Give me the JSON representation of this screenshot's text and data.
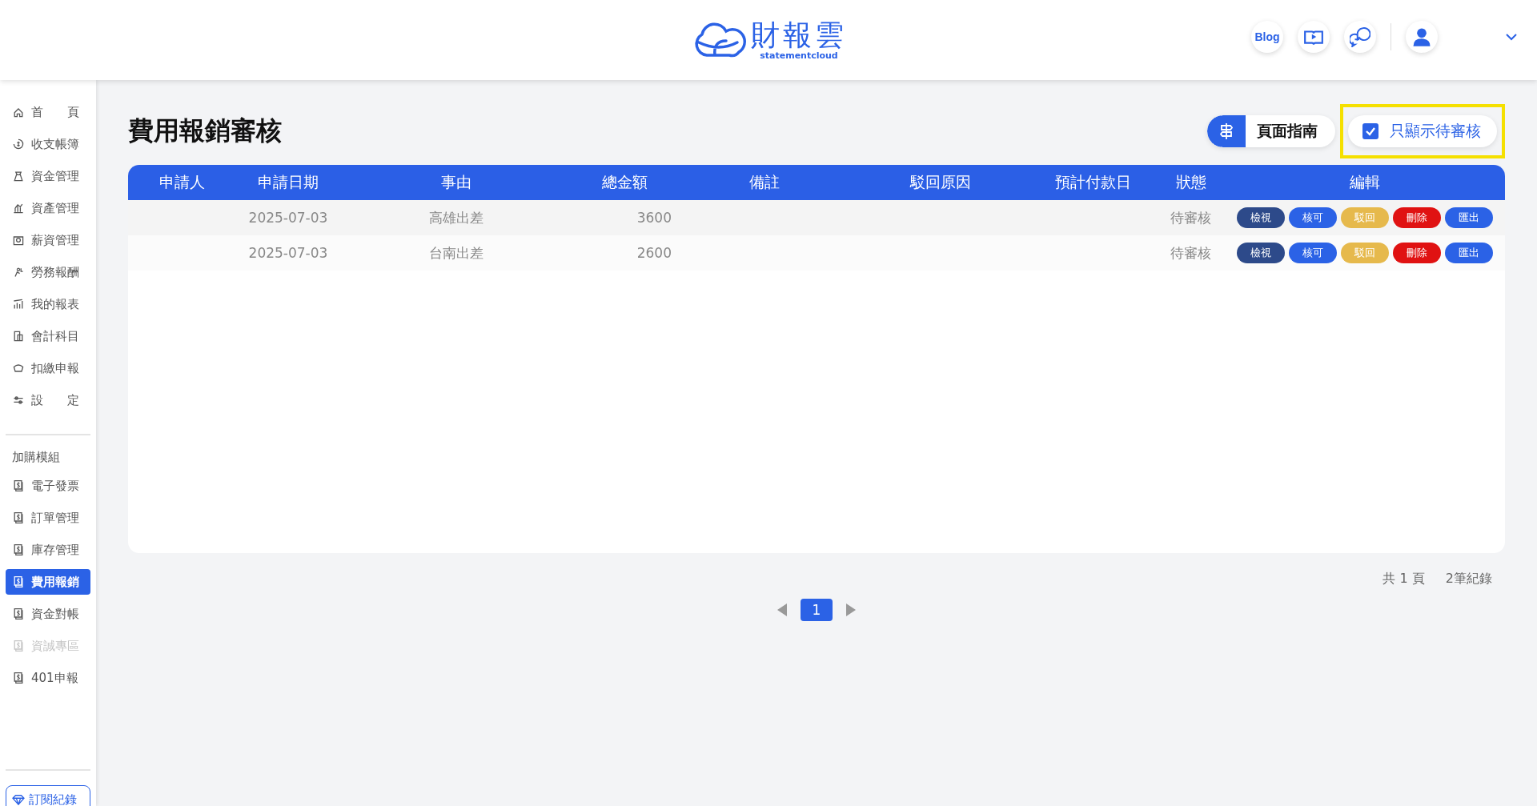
{
  "header": {
    "logo_text": "財報雲",
    "logo_subtext": "statementcloud",
    "blog_label": "Blog"
  },
  "sidebar": {
    "main_items": [
      {
        "label": "首　　頁",
        "selected": false
      },
      {
        "label": "收支帳簿",
        "selected": false
      },
      {
        "label": "資金管理",
        "selected": false
      },
      {
        "label": "資產管理",
        "selected": false
      },
      {
        "label": "薪資管理",
        "selected": false
      },
      {
        "label": "勞務報酬",
        "selected": false
      },
      {
        "label": "我的報表",
        "selected": false
      },
      {
        "label": "會計科目",
        "selected": false
      },
      {
        "label": "扣繳申報",
        "selected": false
      },
      {
        "label": "設　　定",
        "selected": false
      }
    ],
    "module_heading": "加購模組",
    "module_items": [
      {
        "label": "電子發票",
        "selected": false,
        "disabled": false
      },
      {
        "label": "訂單管理",
        "selected": false,
        "disabled": false
      },
      {
        "label": "庫存管理",
        "selected": false,
        "disabled": false
      },
      {
        "label": "費用報銷",
        "selected": true,
        "disabled": false
      },
      {
        "label": "資金對帳",
        "selected": false,
        "disabled": false
      },
      {
        "label": "資誠專區",
        "selected": false,
        "disabled": true
      },
      {
        "label": "401申報",
        "selected": false,
        "disabled": false
      }
    ],
    "subscription_button": "訂閱紀錄"
  },
  "page": {
    "title": "費用報銷審核",
    "guide_button": "頁面指南",
    "pending_only": {
      "label": "只顯示待審核",
      "checked": true
    }
  },
  "table": {
    "columns": [
      "申請人",
      "申請日期",
      "事由",
      "總金額",
      "備註",
      "駁回原因",
      "預計付款日",
      "狀態",
      "編輯"
    ],
    "rows": [
      {
        "date": "2025-07-03",
        "reason": "高雄出差",
        "amount": "3600",
        "status": "待審核",
        "actions": [
          {
            "label": "檢視",
            "kind": "view"
          },
          {
            "label": "核可",
            "kind": "approve"
          },
          {
            "label": "駁回",
            "kind": "reject"
          },
          {
            "label": "刪除",
            "kind": "delete"
          },
          {
            "label": "匯出",
            "kind": "export"
          }
        ]
      },
      {
        "date": "2025-07-03",
        "reason": "台南出差",
        "amount": "2600",
        "status": "待審核",
        "actions": [
          {
            "label": "檢視",
            "kind": "view"
          },
          {
            "label": "核可",
            "kind": "approve"
          },
          {
            "label": "駁回",
            "kind": "reject"
          },
          {
            "label": "刪除",
            "kind": "delete"
          },
          {
            "label": "匯出",
            "kind": "export"
          }
        ]
      }
    ]
  },
  "pagination": {
    "total_pages": "共 1 頁",
    "total_records": "2筆紀錄",
    "pages": [
      {
        "label": "1",
        "selected": true
      }
    ]
  }
}
